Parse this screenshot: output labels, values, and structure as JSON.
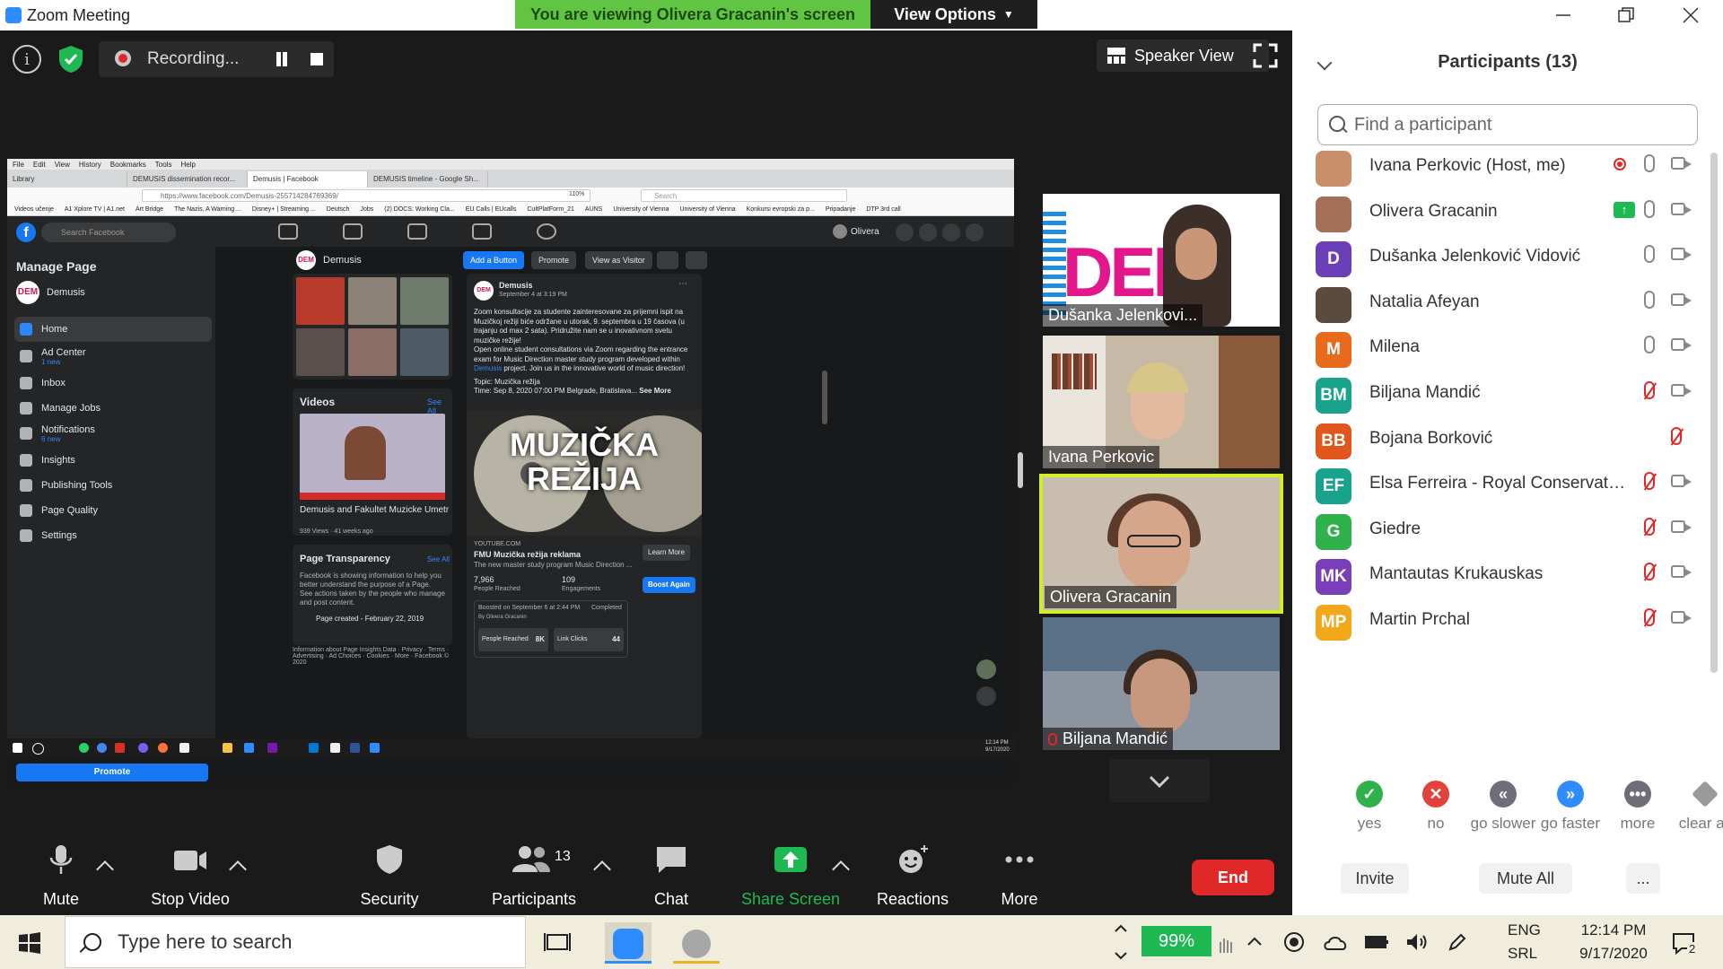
{
  "window": {
    "title": "Zoom Meeting"
  },
  "banner": {
    "viewing": "You are viewing Olivera Gracanin's screen",
    "view_options": "View Options"
  },
  "top_controls": {
    "recording": "Recording...",
    "speaker_view": "Speaker View"
  },
  "shared_screen": {
    "menubar": [
      "File",
      "Edit",
      "View",
      "History",
      "Bookmarks",
      "Tools",
      "Help"
    ],
    "tabs": [
      "Library",
      "DEMUSIS dissemination recor...",
      "Demusis | Facebook",
      "DEMUSIS timeline - Google Sh..."
    ],
    "url": "https://www.facebook.com/Demusis-255714284769369/",
    "zoom": "110%",
    "search_placeholder": "Search",
    "bookmarks": [
      "Videos učenje",
      "A1 Xplore TV | A1.net",
      "Art Bridge",
      "The Nazis, A Warning ...",
      "Disney+ | Streaming ...",
      "Deutsch",
      "Jobs",
      "(2) DOCS: Working Cla...",
      "EU Calls | EUcalls",
      "CultPlatForm_21",
      "AUNS",
      "University of Vienna",
      "University of Vienna",
      "Konkursi evropski za p...",
      "Pripadanje",
      "DTP 3rd call"
    ],
    "fb_search": "Search Facebook",
    "fb_user": "Olivera",
    "manage_page": "Manage Page",
    "page_name": "Demusis",
    "page_avatar": "DEM",
    "menu": [
      {
        "label": "Home",
        "sub": ""
      },
      {
        "label": "Ad Center",
        "sub": "1 new"
      },
      {
        "label": "Inbox",
        "sub": ""
      },
      {
        "label": "Manage Jobs",
        "sub": ""
      },
      {
        "label": "Notifications",
        "sub": "6 new"
      },
      {
        "label": "Insights",
        "sub": ""
      },
      {
        "label": "Publishing Tools",
        "sub": ""
      },
      {
        "label": "Page Quality",
        "sub": ""
      },
      {
        "label": "Settings",
        "sub": ""
      }
    ],
    "promote": "Promote",
    "top_buttons": {
      "add": "Add a Button",
      "promote": "Promote",
      "visitor": "View as Visitor"
    },
    "videos_title": "Videos",
    "see_all": "See All",
    "video_title": "Demusis and Fakultet Muzicke Umetnost...",
    "video_meta": "939 Views · 41 weeks ago",
    "transparency_title": "Page Transparency",
    "transparency_text": "Facebook is showing information to help you better understand the purpose of a Page. See actions taken by the people who manage and post content.",
    "page_created": "Page created - February 22, 2019",
    "footer": "Information about Page Insights Data · Privacy · Terms · Advertising · Ad Choices · Cookies · More · Facebook © 2020",
    "post": {
      "author": "Demusis",
      "date": "September 4 at 3:19 PM",
      "text_sr": "Zoom konsultacije za studente zainteresovane za prijemni ispit na Muzičkoj režiji biće održane u utorak, 9. septembra u 19 časova (u trajanju od max 2 sata). Pridružite nam se u inovativnom svetu muzičke režije!",
      "text_en_1": "Open online student consultations via Zoom regarding the entrance exam for Music Direction master study program developed within",
      "text_en_link": "Demusis",
      "text_en_2": "project. Join us in the innovative world of music direction!",
      "topic": "Topic: Muzička režija",
      "time": "Time: Sep 8, 2020 07:00 PM Belgrade, Bratislava...",
      "see_more": "See More",
      "image_title": "MUZIČKA REŽIJA",
      "source": "YOUTUBE.COM",
      "link_title": "FMU Muzička režija reklama",
      "link_desc": "The new master study program Music Direction ...",
      "learn_more": "Learn More",
      "reach": "7,966",
      "reach_label": "People Reached",
      "engagements": "109",
      "engagements_label": "Engagements",
      "boost": "Boost Again",
      "boosted_on": "Boosted on September 6 at 2:44 PM",
      "completed": "Completed",
      "by": "By Olivera Gracanin",
      "metric1_label": "People Reached",
      "metric1_value": "8K",
      "metric2_label": "Link Clicks",
      "metric2_value": "44"
    },
    "clock": [
      "12:14 PM",
      "9/17/2020"
    ]
  },
  "gallery": [
    {
      "name": "Dušanka Jelenkovi..."
    },
    {
      "name": "Ivana Perkovic"
    },
    {
      "name": "Olivera Gracanin"
    },
    {
      "name": "Biljana Mandić"
    }
  ],
  "toolbar": {
    "mute": "Mute",
    "stop_video": "Stop Video",
    "security": "Security",
    "participants": "Participants",
    "participants_count": "13",
    "chat": "Chat",
    "share_screen": "Share Screen",
    "reactions": "Reactions",
    "more": "More",
    "end": "End"
  },
  "panel": {
    "title": "Participants (13)",
    "search_placeholder": "Find a participant",
    "participants": [
      {
        "name": "Ivana Perkovic (Host, me)",
        "initials": "",
        "color": "#c98f6a",
        "mic": "on",
        "extra": "recording"
      },
      {
        "name": "Olivera Gracanin",
        "initials": "",
        "color": "#a4705a",
        "mic": "on",
        "extra": "sharing"
      },
      {
        "name": "Dušanka Jelenković Vidović",
        "initials": "D",
        "color": "#6b3fb8",
        "mic": "on",
        "extra": ""
      },
      {
        "name": "Natalia Afeyan",
        "initials": "",
        "color": "#5b4a3e",
        "mic": "on",
        "extra": ""
      },
      {
        "name": "Milena",
        "initials": "M",
        "color": "#e86a1c",
        "mic": "on",
        "extra": ""
      },
      {
        "name": "Biljana Mandić",
        "initials": "BM",
        "color": "#1aa38c",
        "mic": "muted",
        "extra": ""
      },
      {
        "name": "Bojana Borković",
        "initials": "BB",
        "color": "#e0561c",
        "mic": "muted",
        "extra": "nocam"
      },
      {
        "name": "Elsa Ferreira - Royal Conservatoi...",
        "initials": "EF",
        "color": "#1aa38c",
        "mic": "muted",
        "extra": ""
      },
      {
        "name": "Giedre",
        "initials": "G",
        "color": "#2fb24c",
        "mic": "muted",
        "extra": ""
      },
      {
        "name": "Mantautas Krukauskas",
        "initials": "MK",
        "color": "#7a3fb8",
        "mic": "muted",
        "extra": ""
      },
      {
        "name": "Martin Prchal",
        "initials": "MP",
        "color": "#f2a81a",
        "mic": "muted",
        "extra": ""
      }
    ],
    "feedback": [
      {
        "label": "yes",
        "symbol": "✓",
        "color": "#2fb24c"
      },
      {
        "label": "no",
        "symbol": "✕",
        "color": "#e0433a"
      },
      {
        "label": "go slower",
        "symbol": "«",
        "color": "#6e6e7a"
      },
      {
        "label": "go faster",
        "symbol": "»",
        "color": "#2d8cff"
      },
      {
        "label": "more",
        "symbol": "•••",
        "color": "#6e6e7a"
      },
      {
        "label": "clear all",
        "symbol": "◆",
        "color": "#9a9a9a"
      }
    ],
    "invite": "Invite",
    "mute_all": "Mute All",
    "more": "..."
  },
  "taskbar": {
    "search": "Type here to search",
    "battery": "99%",
    "lang1": "ENG",
    "lang2": "SRL",
    "time": "12:14 PM",
    "date": "9/17/2020",
    "notifications": "2"
  }
}
